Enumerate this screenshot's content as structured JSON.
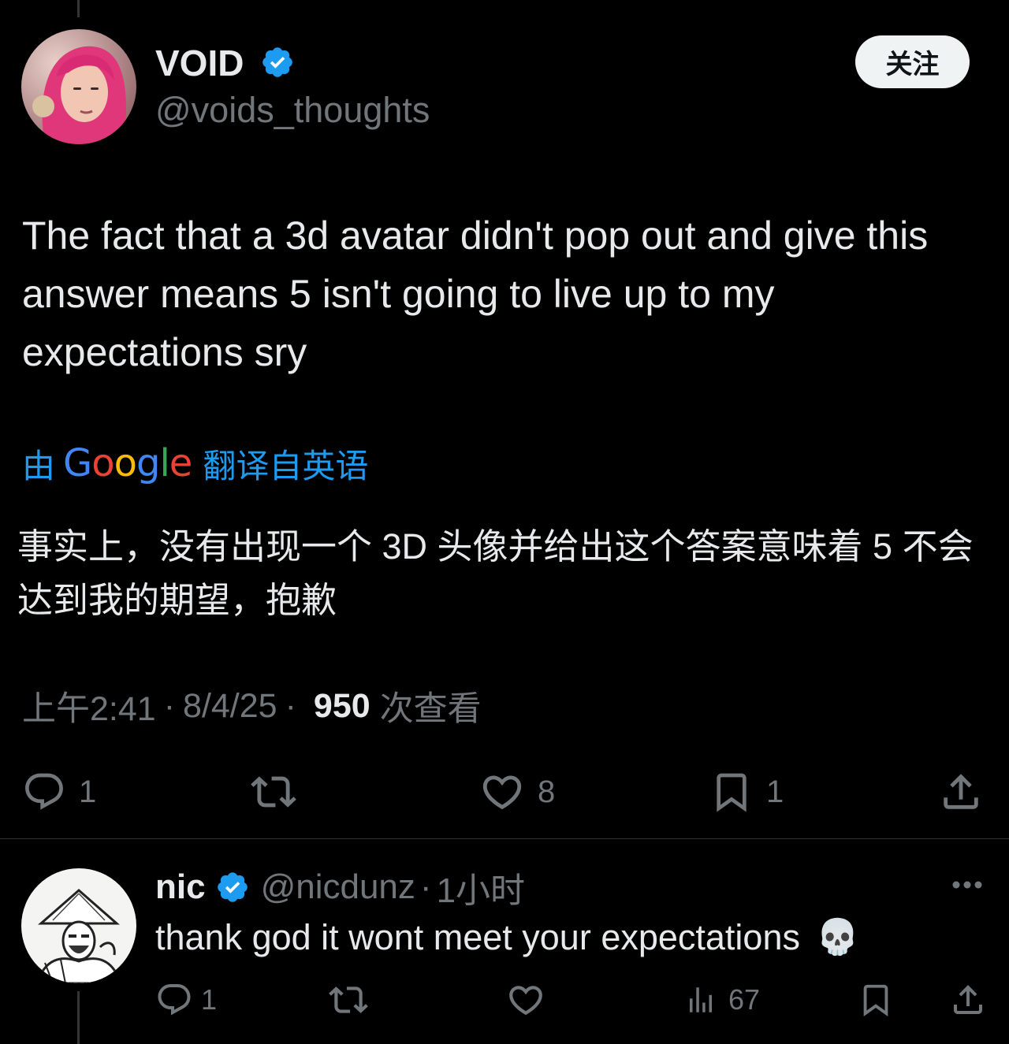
{
  "main_tweet": {
    "author": {
      "display_name": "VOID",
      "handle": "@voids_thoughts",
      "verified": true,
      "avatar_icon": "avatar-pink-hair"
    },
    "follow_label": "关注",
    "text": "The fact that a 3d avatar didn't pop out and give this answer means 5 isn't going to live up to my expectations sry",
    "translation": {
      "prefix": "由",
      "provider": "Google",
      "suffix": "翻译自英语",
      "text": "事实上，没有出现一个 3D 头像并给出这个答案意味着 5 不会达到我的期望，抱歉"
    },
    "meta": {
      "time": "上午2:41",
      "sep1": "·",
      "date": "8/4/25",
      "sep2": "·",
      "views": "950",
      "views_label": "次查看"
    },
    "actions": {
      "reply_count": "1",
      "retweet_count": "",
      "like_count": "8",
      "bookmark_count": "1"
    }
  },
  "reply": {
    "author": {
      "display_name": "nic",
      "handle": "@nicdunz",
      "verified": true,
      "avatar_icon": "avatar-ink-sketch"
    },
    "sep": "·",
    "time_ago": "1小时",
    "text": "thank god it wont meet your expectations",
    "emoji": "💀",
    "actions": {
      "reply_count": "1",
      "retweet_count": "",
      "like_count": "",
      "views_count": "67"
    }
  },
  "colors": {
    "background": "#000000",
    "text_primary": "#e7e9ea",
    "text_secondary": "#71767b",
    "accent_blue": "#1d9bf0",
    "follow_bg": "#eff3f4",
    "divider": "#2f3336"
  }
}
